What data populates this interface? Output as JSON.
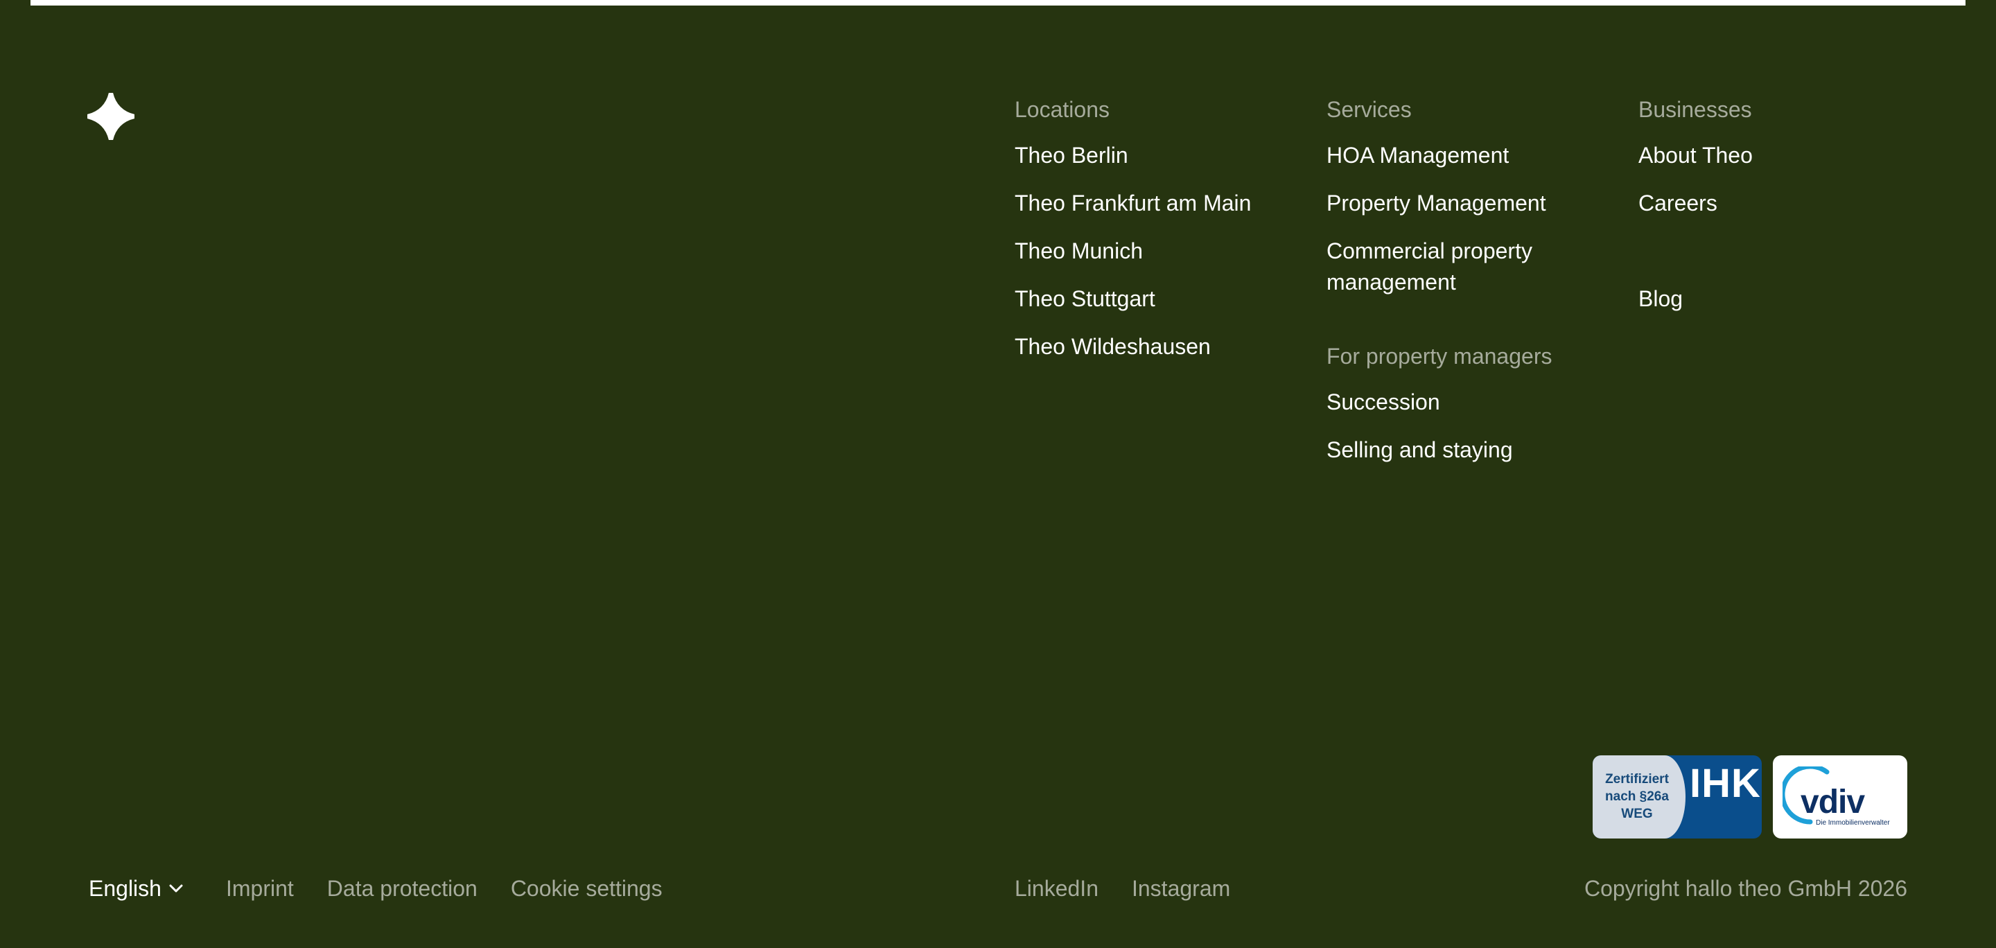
{
  "footer": {
    "columns": [
      {
        "heading": "Locations",
        "links": [
          "Theo Berlin",
          "Theo Frankfurt am Main",
          "Theo Munich",
          "Theo Stuttgart",
          "Theo Wildeshausen"
        ]
      },
      {
        "heading": "Services",
        "links": [
          "HOA Management",
          "Property Management",
          "Commercial property management"
        ]
      },
      {
        "heading": "Businesses",
        "links": [
          "About Theo",
          "Careers",
          "Blog"
        ]
      }
    ],
    "managers": {
      "heading": "For property managers",
      "links": [
        "Succession",
        "Selling and staying"
      ]
    },
    "badges": {
      "ihk": {
        "line1": "Zertifiziert",
        "line2": "nach §26a",
        "line3": "WEG",
        "mark": "IHK"
      },
      "vdiv": {
        "word": "vdiv",
        "tagline": "Die Immobilienverwalter"
      }
    },
    "language": {
      "selected": "English"
    },
    "legal_links": [
      "Imprint",
      "Data protection",
      "Cookie settings"
    ],
    "social_links": [
      "LinkedIn",
      "Instagram"
    ],
    "copyright": "Copyright hallo theo GmbH 2026"
  },
  "colors": {
    "background": "#263410",
    "text": "#ffffff",
    "muted": "#a6ab9c",
    "ihk_blue": "#0a4e8c",
    "vdiv_cyan": "#1ea0d8",
    "vdiv_navy": "#0d2f63"
  },
  "icons": {
    "logo": "four-point-star-icon",
    "language_toggle": "chevron-down-icon"
  }
}
